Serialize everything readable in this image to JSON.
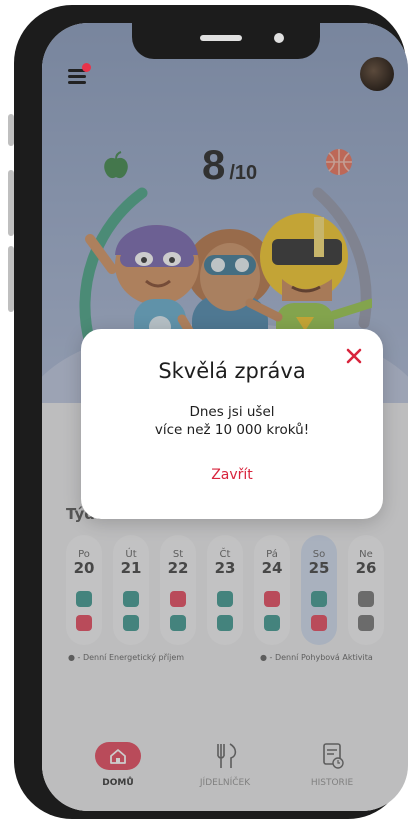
{
  "header": {
    "score_value": "8",
    "score_max": "/10",
    "menu_icon": "hamburger-menu-icon",
    "avatar_icon": "user-avatar"
  },
  "week": {
    "title": "Týden hodnocení",
    "days": [
      {
        "name": "Po",
        "num": "20"
      },
      {
        "name": "Út",
        "num": "21"
      },
      {
        "name": "St",
        "num": "22"
      },
      {
        "name": "Čt",
        "num": "23"
      },
      {
        "name": "Pá",
        "num": "24"
      },
      {
        "name": "So",
        "num": "25"
      },
      {
        "name": "Ne",
        "num": "26"
      }
    ],
    "legend_energy": "- Denní Energetický příjem",
    "legend_activity": "- Denní Pohybová Aktivita"
  },
  "modal": {
    "title": "Skvělá zpráva",
    "message_line1": "Dnes jsi ušel",
    "message_line2": "více než 10 000 kroků!",
    "action_label": "Zavřít"
  },
  "nav": {
    "home_label": "DOMŮ",
    "menu_label": "JÍDELNÍČEK",
    "history_label": "HISTORIE"
  },
  "colors": {
    "accent": "#e23a50",
    "status_green": "#2e8f86",
    "status_red": "#e23a50",
    "status_gray": "#6b6b6b"
  }
}
